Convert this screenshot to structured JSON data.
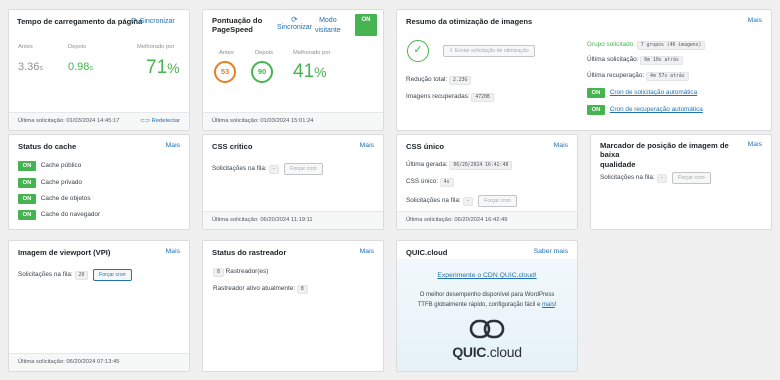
{
  "load_time": {
    "title": "Tempo de carregamento da página",
    "sync": "Sincronizar",
    "before_label": "Antes",
    "before_value": "3.36",
    "before_unit": "s",
    "after_label": "Depois",
    "after_value": "0.98",
    "after_unit": "s",
    "improved_label": "Melhorado por",
    "improved_value": "71",
    "pct": "%",
    "footer": "Última solicitação: 01/03/2024 14:45:17",
    "redetect": "Redetectar"
  },
  "pagespeed": {
    "title_line1": "Pontuação do",
    "title_line2": "PageSpeed",
    "sync": "Sincronizar",
    "mode_line1": "Modo",
    "mode_line2": "visitante",
    "toggle": "ON",
    "before_label": "Antes",
    "before_score": "53",
    "after_label": "Depois",
    "after_score": "90",
    "improved_label": "Melhorado por",
    "improved_value": "41",
    "pct": "%",
    "footer": "Última solicitação: 01/03/2024 15:01:24"
  },
  "image_opt": {
    "title": "Resumo da otimização de imagens",
    "more": "Mais",
    "send_button": "Enviar solicitação de otimização",
    "reduction_label": "Redução total:",
    "reduction_value": "2.23G",
    "recovered_label": "Imagens recuperadas:",
    "recovered_value": "47208",
    "requested_label": "Grupo solicitado:",
    "requested_value": "7 grupos (46 imagens)",
    "last_request_label": "Última solicitação:",
    "last_request_value": "6m 10s atrás",
    "last_recovery_label": "Última recuperação:",
    "last_recovery_value": "4m 57s atrás",
    "cron1_toggle": "ON",
    "cron1_link": "Cron de solicitação automática",
    "cron2_toggle": "ON",
    "cron2_link": "Cron de recuperação automática"
  },
  "cache": {
    "title": "Status do cache",
    "more": "Mais",
    "items": [
      {
        "toggle": "ON",
        "label": "Cache público"
      },
      {
        "toggle": "ON",
        "label": "Cache privado"
      },
      {
        "toggle": "ON",
        "label": "Cache de objetos"
      },
      {
        "toggle": "ON",
        "label": "Cache do navegador"
      }
    ]
  },
  "critical_css": {
    "title": "CSS crítico",
    "more": "Mais",
    "queue_label": "Solicitações na fila:",
    "queue_value": "-",
    "force_button": "Forçar cron",
    "footer": "Última solicitação: 06/20/2024 11:19:11"
  },
  "unique_css": {
    "title": "CSS único",
    "more": "Mais",
    "last_gen_label": "Última gerada:",
    "last_gen_value": "06/20/2024 16:42:48",
    "count_label": "CSS único:",
    "count_value": "4s",
    "queue_label": "Solicitações na fila:",
    "queue_value": "-",
    "force_button": "Forçar cron",
    "footer": "Última solicitação: 06/20/2024 16:42:49"
  },
  "placeholder": {
    "title_line1": "Marcador de posição de imagem de baixa",
    "title_line2": "qualidade",
    "more": "Mais",
    "queue_label": "Solicitações na fila:",
    "queue_value": "-",
    "force_button": "Forçar cron"
  },
  "vpi": {
    "title": "Imagem de viewport (VPI)",
    "more": "Mais",
    "queue_label": "Solicitações na fila:",
    "queue_value": "29",
    "force_button": "Forçar cron",
    "footer": "Última solicitação: 06/20/2024 07:13:45"
  },
  "crawler": {
    "title": "Status do rastreador",
    "more": "Mais",
    "count": "8",
    "count_label": "Rastreador(es)",
    "active_label": "Rastreador ativo atualmente:",
    "active_value": "8"
  },
  "quic": {
    "title": "QUIC.cloud",
    "more": "Saber mais",
    "cta": "Experimente o CDN QUIC.cloud!",
    "desc_line1": "O melhor desempenho disponível para WordPress",
    "desc_line2": "TTFB globalmente rápido, configuração fácil e",
    "desc_link": "mais",
    "desc_end": "!",
    "logo_text": "QUIC",
    "logo_text2": ".cloud"
  }
}
